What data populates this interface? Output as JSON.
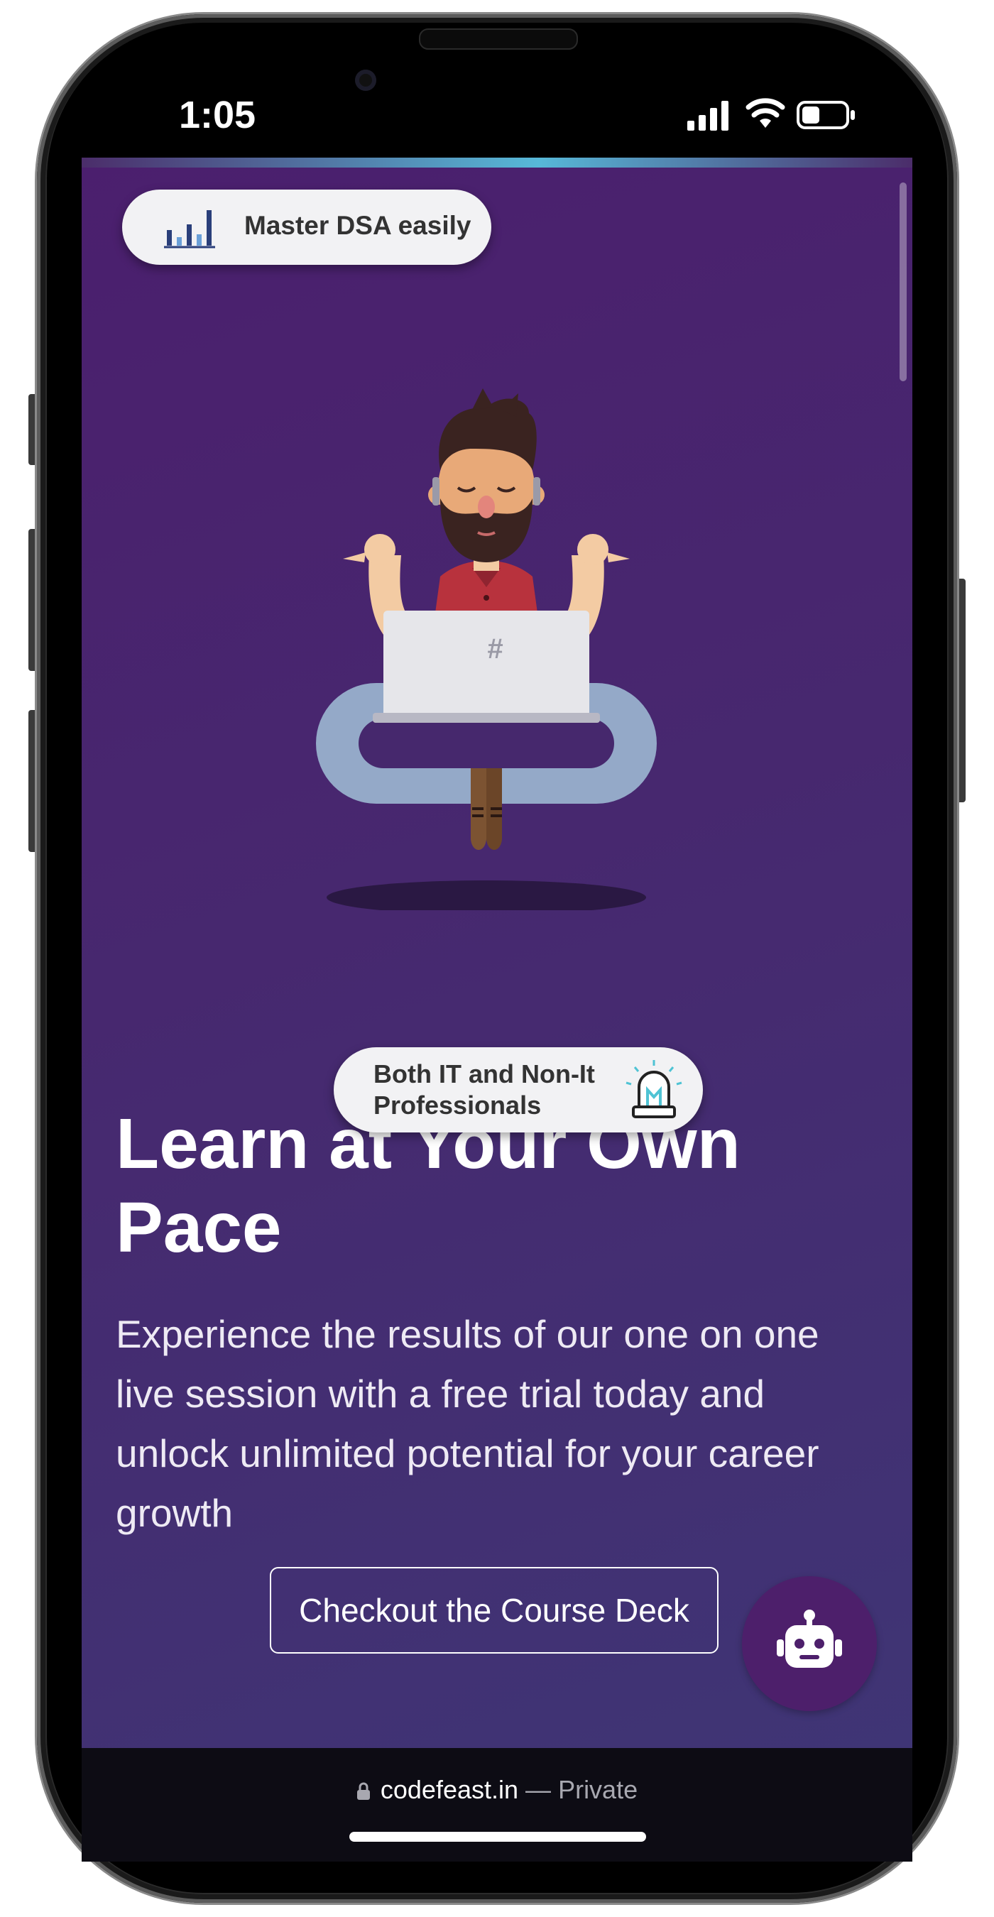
{
  "status_bar": {
    "time": "1:05"
  },
  "page": {
    "badge_dsa": "Master DSA easily",
    "badge_professionals": "Both IT and Non-It Professionals",
    "hero_title": "Learn at Your Own Pace",
    "hero_text": "Experience the results of our one on one live session with a free trial today and unlock unlimited potential for your career growth",
    "cta_label": "Checkout the Course Deck",
    "laptop_symbol": "#"
  },
  "browser": {
    "domain": "codefeast.in",
    "separator": "—",
    "mode": "Private"
  },
  "colors": {
    "bg_gradient_start": "#4b1f6e",
    "bg_gradient_end": "#3f3575",
    "chatbot_bg": "#4d1f6b",
    "accent_glow": "#57b8d8"
  },
  "icons": {
    "badge_dsa": "bar-chart-icon",
    "badge_professionals": "lightbulb-icon",
    "chat": "robot-icon",
    "url": "lock-icon"
  }
}
